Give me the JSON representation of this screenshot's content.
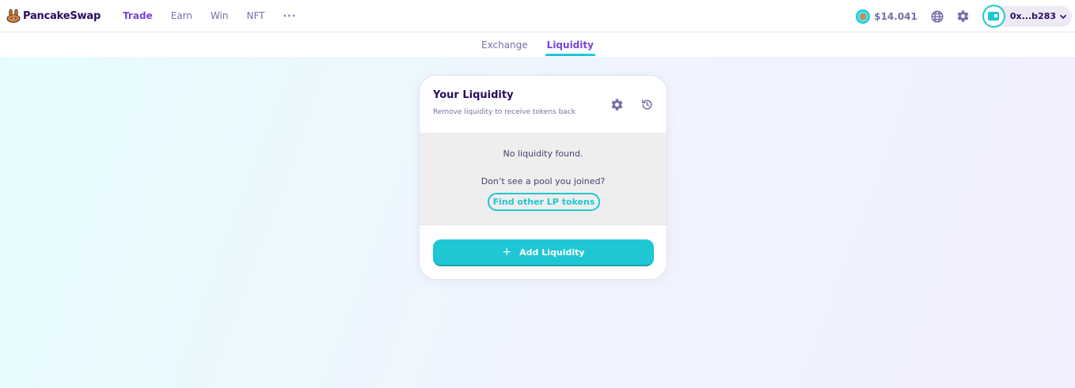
{
  "brand": {
    "name": "PancakeSwap"
  },
  "nav": {
    "items": [
      {
        "label": "Trade",
        "active": true
      },
      {
        "label": "Earn",
        "active": false
      },
      {
        "label": "Win",
        "active": false
      },
      {
        "label": "NFT",
        "active": false
      }
    ],
    "more": "···"
  },
  "header": {
    "cake_price": "$14.041",
    "wallet_address": "0x...b283"
  },
  "subnav": {
    "tabs": [
      {
        "label": "Exchange",
        "active": false
      },
      {
        "label": "Liquidity",
        "active": true
      }
    ]
  },
  "liquidity_card": {
    "title": "Your Liquidity",
    "subtitle": "Remove liquidity to receive tokens back",
    "empty_message": "No liquidity found.",
    "hint": "Don’t see a pool you joined?",
    "find_button": "Find other LP tokens",
    "add_button": "Add Liquidity",
    "add_icon": "+"
  },
  "colors": {
    "primary": "#1fc7d4",
    "secondary": "#7645d9",
    "text": "#280d5f",
    "text_subtle": "#7a6eaa"
  },
  "icons": [
    "bunny-logo-icon",
    "cake-token-icon",
    "globe-icon",
    "gear-icon",
    "wallet-icon",
    "chevron-down-icon",
    "history-icon"
  ]
}
